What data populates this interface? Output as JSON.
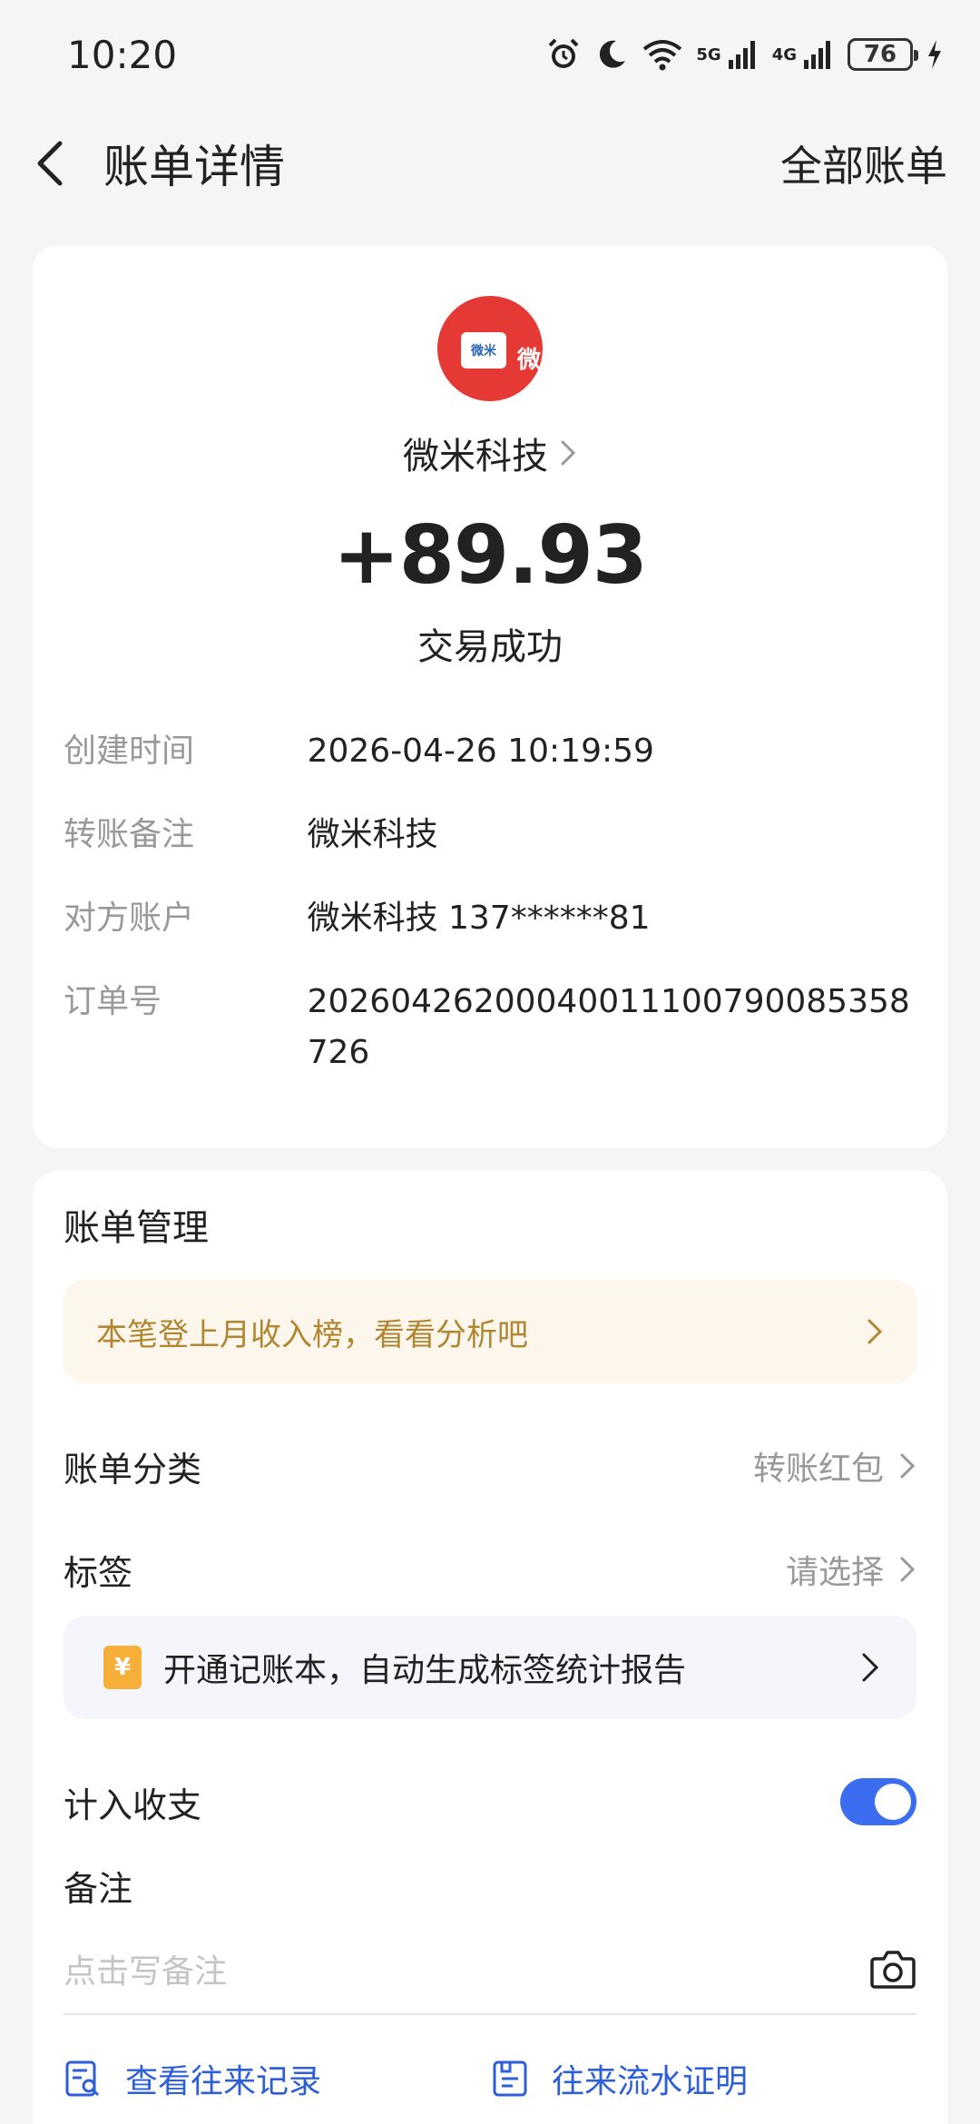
{
  "status_bar": {
    "time": "10:20",
    "net1": "5G",
    "net2": "4G",
    "battery": "76",
    "icons": [
      "alarm-icon",
      "moon-icon",
      "wifi-icon",
      "signal-icon",
      "signal-icon",
      "battery-icon",
      "charging-icon"
    ]
  },
  "nav": {
    "title": "账单详情",
    "right_link": "全部账单"
  },
  "merchant": {
    "logo_text": "微米",
    "logo_side_text": "微",
    "name": "微米科技",
    "amount": "+89.93",
    "status": "交易成功"
  },
  "details": [
    {
      "label": "创建时间",
      "value": "2026-04-26 10:19:59"
    },
    {
      "label": "转账备注",
      "value": "微米科技"
    },
    {
      "label": "对方账户",
      "value": "微米科技 137******81"
    },
    {
      "label": "订单号",
      "value": "20260426200040011100790085358726"
    }
  ],
  "manage": {
    "title": "账单管理",
    "income_banner": "本笔登上月收入榜，看看分析吧",
    "category_label": "账单分类",
    "category_value": "转账红包",
    "tag_label": "标签",
    "tag_value": "请选择",
    "book_banner": "开通记账本，自动生成标签统计报告",
    "book_icon_glyph": "¥",
    "include_label": "计入收支",
    "include_on": true,
    "note_label": "备注",
    "note_placeholder": "点击写备注",
    "link_history": "查看往来记录",
    "link_proof": "往来流水证明"
  },
  "colors": {
    "accent_blue": "#3b6df0",
    "link_blue": "#2d5fd8",
    "banner_gold": "#b08730",
    "logo_red": "#e53935"
  }
}
